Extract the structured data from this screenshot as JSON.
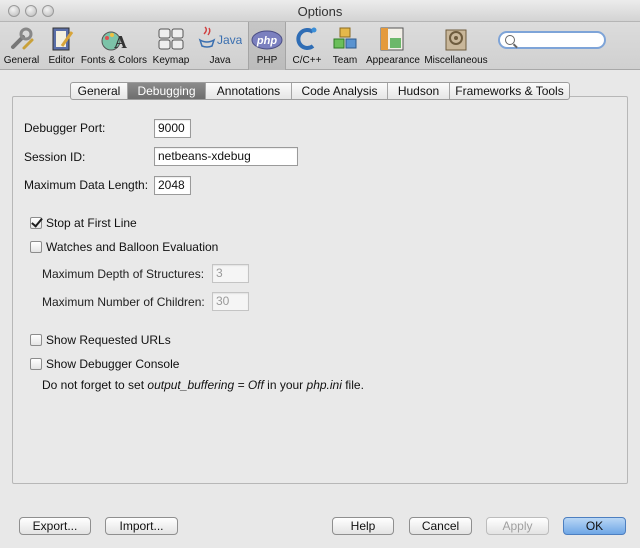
{
  "window": {
    "title": "Options"
  },
  "toolbar": {
    "items": [
      {
        "label": "General",
        "icon": "wrench-icon"
      },
      {
        "label": "Editor",
        "icon": "editor-icon"
      },
      {
        "label": "Fonts & Colors",
        "icon": "fonts-colors-icon"
      },
      {
        "label": "Keymap",
        "icon": "keymap-icon"
      },
      {
        "label": "Java",
        "icon": "java-icon"
      },
      {
        "label": "PHP",
        "icon": "php-icon",
        "active": true
      },
      {
        "label": "C/C++",
        "icon": "c-cpp-icon"
      },
      {
        "label": "Team",
        "icon": "team-icon"
      },
      {
        "label": "Appearance",
        "icon": "appearance-icon"
      },
      {
        "label": "Miscellaneous",
        "icon": "miscellaneous-icon"
      }
    ],
    "icon_text": {
      "java": "Java",
      "php": "php"
    }
  },
  "search": {
    "placeholder": ""
  },
  "tabs": [
    {
      "label": "General"
    },
    {
      "label": "Debugging",
      "active": true
    },
    {
      "label": "Annotations"
    },
    {
      "label": "Code Analysis"
    },
    {
      "label": "Hudson"
    },
    {
      "label": "Frameworks & Tools"
    }
  ],
  "form": {
    "debugger_port": {
      "label": "Debugger Port:",
      "value": "9000"
    },
    "session_id": {
      "label": "Session ID:",
      "value": "netbeans-xdebug"
    },
    "max_data_length": {
      "label": "Maximum Data Length:",
      "value": "2048"
    },
    "stop_first_line": {
      "label": "Stop at First Line",
      "checked": true
    },
    "watches_balloon": {
      "label": "Watches and Balloon Evaluation",
      "checked": false
    },
    "max_depth": {
      "label": "Maximum Depth of Structures:",
      "value": "3"
    },
    "max_children": {
      "label": "Maximum Number of Children:",
      "value": "30"
    },
    "show_urls": {
      "label": "Show Requested URLs",
      "checked": false
    },
    "show_console": {
      "label": "Show Debugger Console",
      "checked": false
    },
    "note": {
      "prefix": "Do not forget to set ",
      "setting": "output_buffering = Off",
      "middle": " in your ",
      "file": "php.ini",
      "suffix": " file."
    }
  },
  "buttons": {
    "export": "Export...",
    "import": "Import...",
    "help": "Help",
    "cancel": "Cancel",
    "apply": "Apply",
    "ok": "OK"
  },
  "colors": {
    "accent": "#6fa6e6",
    "active_tab": "#7a7a7a"
  }
}
